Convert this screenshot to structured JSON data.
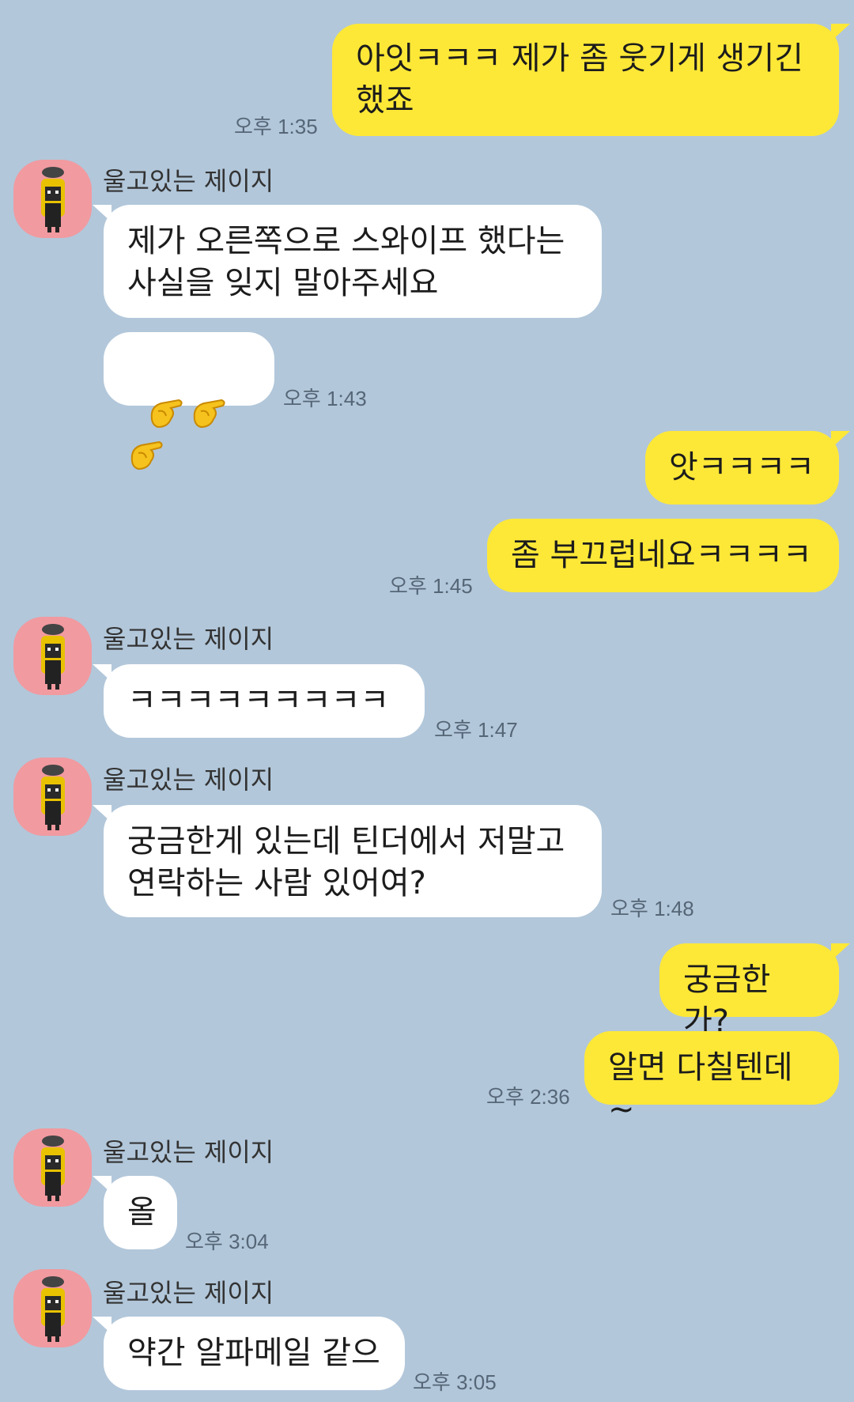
{
  "contact_name": "울고있는 제이지",
  "messages": [
    {
      "sender": "me",
      "text": "아잇ㅋㅋㅋ 제가 좀 웃기게 생기긴\n했죠",
      "time": "오후 1:35"
    },
    {
      "sender": "them",
      "text": "제가 오른쪽으로 스와이프 했다는\n사실을 잊지 말아주세요"
    },
    {
      "sender": "them",
      "emoji": "pointing-finger-icon x3",
      "time": "오후 1:43"
    },
    {
      "sender": "me",
      "text": "앗ㅋㅋㅋㅋ"
    },
    {
      "sender": "me",
      "text": "좀 부끄럽네요ㅋㅋㅋㅋ",
      "time": "오후 1:45"
    },
    {
      "sender": "them",
      "text": "ㅋㅋㅋㅋㅋㅋㅋㅋㅋ",
      "time": "오후 1:47"
    },
    {
      "sender": "them",
      "text": "궁금한게 있는데 틴더에서 저말고\n연락하는 사람 있어여?",
      "time": "오후 1:48"
    },
    {
      "sender": "me",
      "text": "궁금한가?"
    },
    {
      "sender": "me",
      "text": "알면 다칠텐데~",
      "time": "오후 2:36"
    },
    {
      "sender": "them",
      "text": "올",
      "time": "오후 3:04"
    },
    {
      "sender": "them",
      "text": "약간 알파메일 같으",
      "time": "오후 3:05"
    }
  ],
  "colors": {
    "background": "#b2c7da",
    "my_bubble": "#fee837",
    "their_bubble": "#ffffff",
    "avatar_bg": "#f19aa0"
  }
}
